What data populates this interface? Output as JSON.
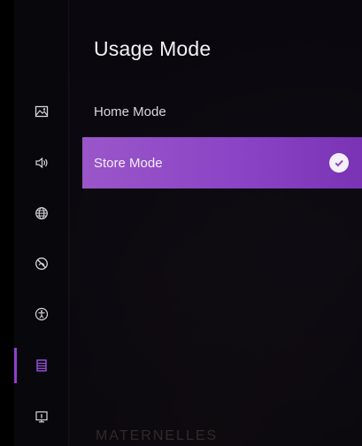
{
  "menu": {
    "title": "Usage Mode",
    "options": [
      {
        "label": "Home Mode",
        "selected": false
      },
      {
        "label": "Store Mode",
        "selected": true,
        "indicator": "check-circle-icon"
      }
    ]
  },
  "sidebar": {
    "items": [
      {
        "icon": "picture-icon",
        "active": false
      },
      {
        "icon": "sound-icon",
        "active": false
      },
      {
        "icon": "network-globe-icon",
        "active": false
      },
      {
        "icon": "no-signal-icon",
        "active": false
      },
      {
        "icon": "accessibility-icon",
        "active": false
      },
      {
        "icon": "list-icon",
        "active": true
      },
      {
        "icon": "support-icon",
        "active": false
      }
    ]
  },
  "background": {
    "text": "MATERNELLES"
  },
  "colors": {
    "accent": "#8e3fd0",
    "selected_start": "#9a56c8",
    "selected_end": "#7a33b4",
    "icon": "#d6d4da"
  }
}
